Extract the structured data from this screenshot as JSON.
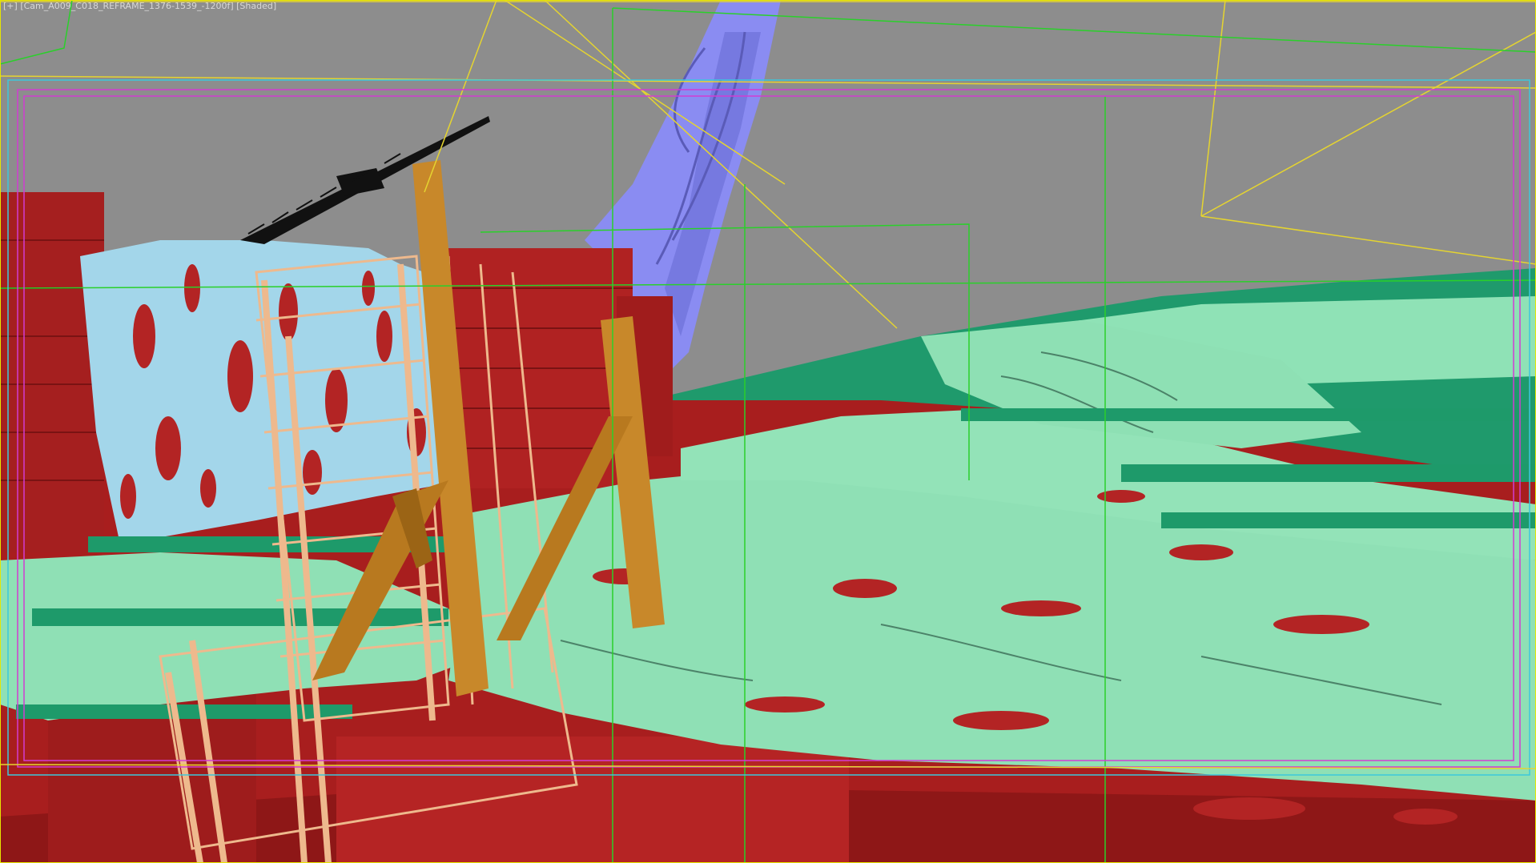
{
  "viewport": {
    "menu_label": "[+]",
    "camera_label": "[Cam_A009_C018_REFRAME_1376-1539_-1200f]",
    "shading_label": "[Shaded]"
  },
  "colors": {
    "background": "#8f8f8f",
    "sky_gray": "#8c8c8c",
    "dark_red": "#a51f1f",
    "water_mint": "#8fe0b5",
    "green_dark": "#1e9a6a",
    "ice_blue": "#9fd6e8",
    "scaffold_peach": "#efb98e",
    "timber_brown": "#c8882a",
    "spire_lavender": "#8c8cf0",
    "crane_black": "#111111",
    "wire_yellow": "#e5d430",
    "wire_green": "#2ad02a",
    "safe_frame_magenta": "#d23cd2",
    "wire_cyan": "#3cc8dc"
  }
}
